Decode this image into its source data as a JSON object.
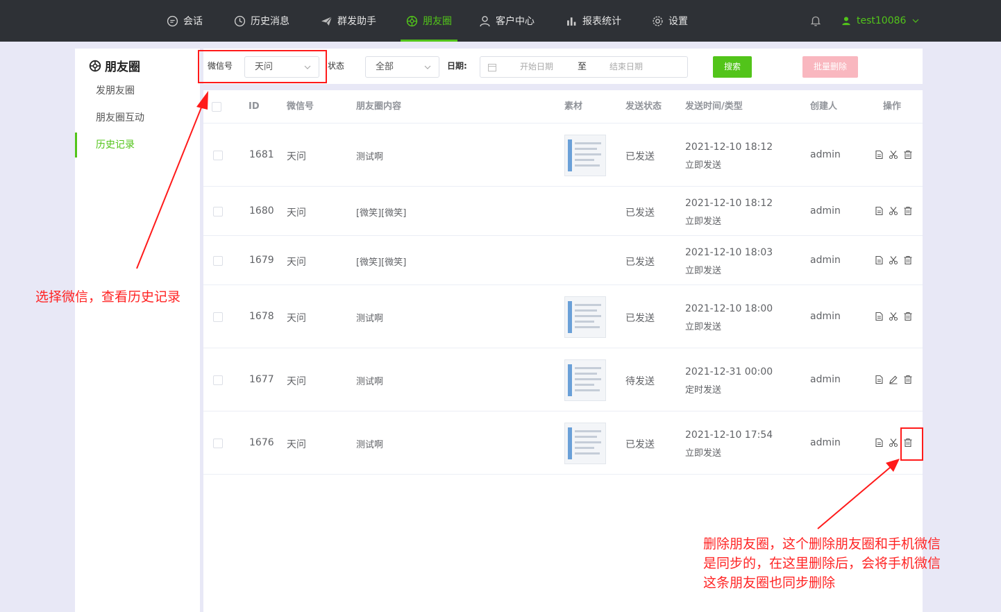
{
  "nav": {
    "items": [
      {
        "label": "会话",
        "icon": "chat-icon"
      },
      {
        "label": "历史消息",
        "icon": "clock-icon"
      },
      {
        "label": "群发助手",
        "icon": "paper-plane-icon"
      },
      {
        "label": "朋友圈",
        "icon": "aperture-icon",
        "active": true
      },
      {
        "label": "客户中心",
        "icon": "user-icon"
      },
      {
        "label": "报表统计",
        "icon": "bar-chart-icon"
      },
      {
        "label": "设置",
        "icon": "gear-icon"
      }
    ],
    "username": "test10086",
    "accent": "#52c41a"
  },
  "sidebar": {
    "title": "朋友圈",
    "items": [
      {
        "label": "发朋友圈"
      },
      {
        "label": "朋友圈互动"
      },
      {
        "label": "历史记录",
        "active": true
      }
    ]
  },
  "filter": {
    "wechat_label": "微信号",
    "wechat_value": "天问",
    "status_label": "状态",
    "status_value": "全部",
    "date_label": "日期:",
    "start_placeholder": "开始日期",
    "range_sep": "至",
    "end_placeholder": "结束日期",
    "search_label": "搜索",
    "batch_delete_label": "批量删除"
  },
  "table": {
    "headers": {
      "id": "ID",
      "wechat": "微信号",
      "content": "朋友圈内容",
      "material": "素材",
      "status": "发送状态",
      "time": "发送时间/类型",
      "creator": "创建人",
      "ops": "操作"
    },
    "rows": [
      {
        "id": "1681",
        "wechat": "天问",
        "content": "测试啊",
        "has_material": true,
        "status": "已发送",
        "time": "2021-12-10 18:12",
        "type": "立即发送",
        "creator": "admin",
        "op2": "scissors-icon"
      },
      {
        "id": "1680",
        "wechat": "天问",
        "content": "[微笑][微笑]",
        "has_material": false,
        "status": "已发送",
        "time": "2021-12-10 18:12",
        "type": "立即发送",
        "creator": "admin",
        "op2": "scissors-icon"
      },
      {
        "id": "1679",
        "wechat": "天问",
        "content": "[微笑][微笑]",
        "has_material": false,
        "status": "已发送",
        "time": "2021-12-10 18:03",
        "type": "立即发送",
        "creator": "admin",
        "op2": "scissors-icon"
      },
      {
        "id": "1678",
        "wechat": "天问",
        "content": "测试啊",
        "has_material": true,
        "status": "已发送",
        "time": "2021-12-10 18:00",
        "type": "立即发送",
        "creator": "admin",
        "op2": "scissors-icon"
      },
      {
        "id": "1677",
        "wechat": "天问",
        "content": "测试啊",
        "has_material": true,
        "status": "待发送",
        "time": "2021-12-31 00:00",
        "type": "定时发送",
        "creator": "admin",
        "op2": "pencil-icon"
      },
      {
        "id": "1676",
        "wechat": "天问",
        "content": "测试啊",
        "has_material": true,
        "status": "已发送",
        "time": "2021-12-10 17:54",
        "type": "立即发送",
        "creator": "admin",
        "op2": "scissors-icon"
      }
    ]
  },
  "annotations": {
    "left_note": "选择微信，查看历史记录",
    "right_note_lines": [
      "删除朋友圈，这个删除朋友圈和手机微信",
      "是同步的，在这里删除后，会将手机微信",
      "这条朋友圈也同步删除"
    ],
    "color": "#ff1a1a"
  }
}
